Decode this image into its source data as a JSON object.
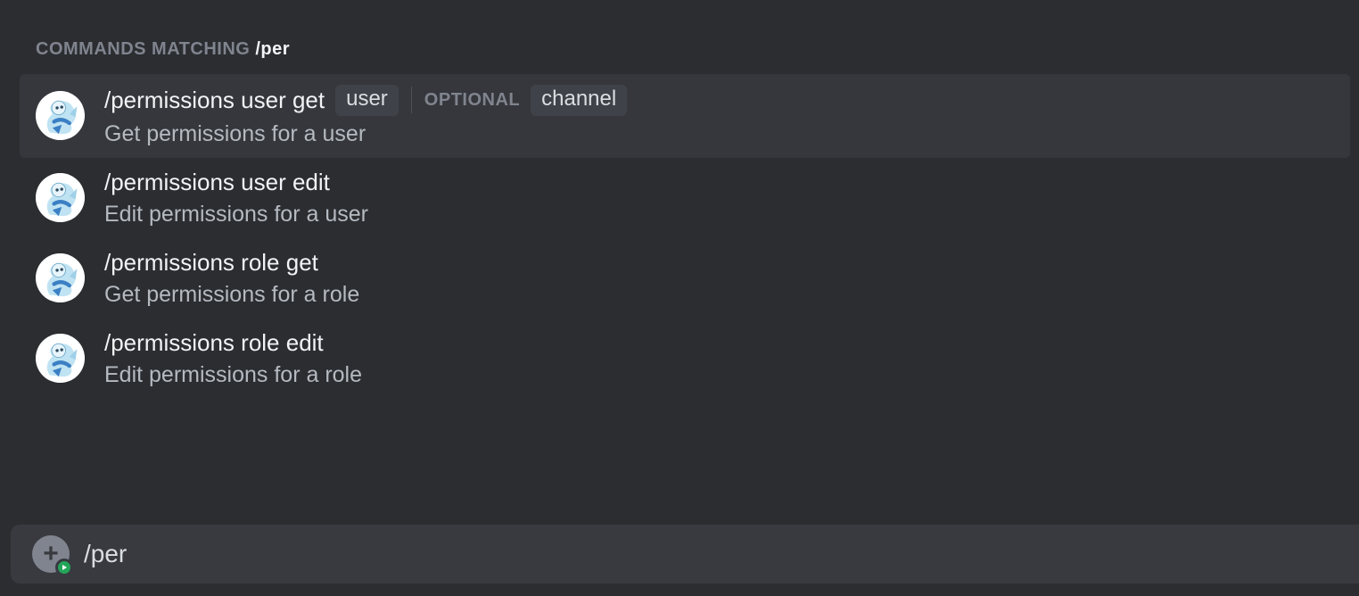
{
  "header": {
    "label": "COMMANDS MATCHING",
    "query": "/per"
  },
  "optional_label": "OPTIONAL",
  "commands": [
    {
      "name": "/permissions user get",
      "description": "Get permissions for a user",
      "params_required": [
        "user"
      ],
      "params_optional": [
        "channel"
      ],
      "selected": true
    },
    {
      "name": "/permissions user edit",
      "description": "Edit permissions for a user",
      "params_required": [],
      "params_optional": [],
      "selected": false
    },
    {
      "name": "/permissions role get",
      "description": "Get permissions for a role",
      "params_required": [],
      "params_optional": [],
      "selected": false
    },
    {
      "name": "/permissions role edit",
      "description": "Edit permissions for a role",
      "params_required": [],
      "params_optional": [],
      "selected": false
    }
  ],
  "input": {
    "value": "/per"
  }
}
